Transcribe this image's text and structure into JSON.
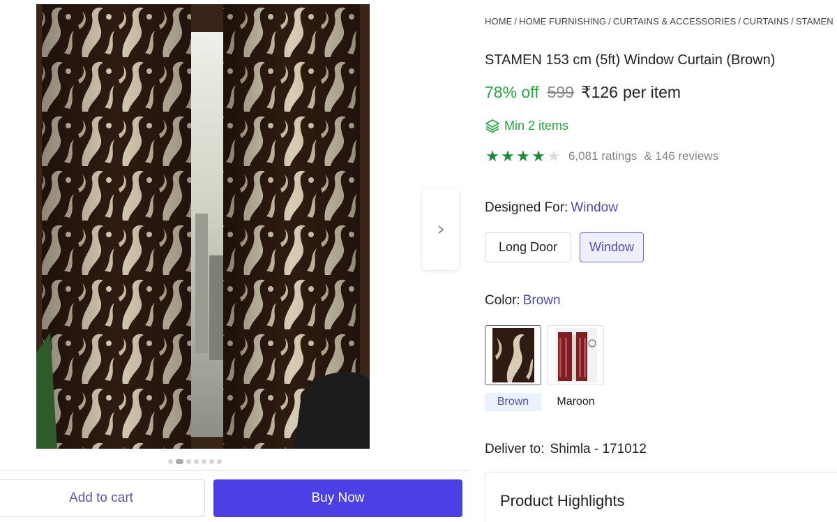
{
  "breadcrumb": [
    "HOME",
    "HOME FURNISHING",
    "CURTAINS & ACCESSORIES",
    "CURTAINS",
    "STAMEN"
  ],
  "product": {
    "title": "STAMEN 153 cm (5ft) Window Curtain (Brown)",
    "discount": "78% off",
    "mrp": "599",
    "price": "₹126",
    "price_suffix": "per item",
    "min_items": "Min 2 items",
    "rating_stars": 4,
    "rating_max": 5,
    "ratings_count": "6,081 ratings",
    "reviews_count": "& 146 reviews"
  },
  "designed_for": {
    "label": "Designed For:",
    "selected": "Window",
    "options": [
      "Long Door",
      "Window"
    ]
  },
  "color": {
    "label": "Color:",
    "selected": "Brown",
    "options": [
      "Brown",
      "Maroon"
    ]
  },
  "delivery": {
    "label": "Deliver to:",
    "location": "Shimla - 171012"
  },
  "highlights": {
    "title": "Product Highlights"
  },
  "gallery": {
    "image_count": 7,
    "active_index": 1
  },
  "actions": {
    "add_to_cart": "Add to cart",
    "buy_now": "Buy Now"
  },
  "colors": {
    "accent": "#4c3fe3",
    "discount_green": "#26a541",
    "link_blue": "#4e4ea8",
    "star_green": "#1d8a3a"
  }
}
